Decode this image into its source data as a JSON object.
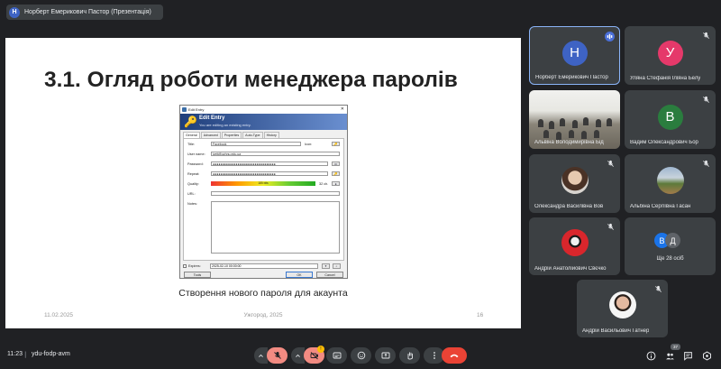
{
  "presenter_bar": {
    "avatar_letter": "Н",
    "title": "Норберт Емерикович Пастор (Презентація)"
  },
  "slide": {
    "title": "3.1. Огляд роботи менеджера паролів",
    "caption": "Створення нового пароля для акаунта",
    "footer_date": "11.02.2025",
    "footer_city": "Ужгород, 2025",
    "page_number": "16"
  },
  "dialog": {
    "window_title": "Edit Entry",
    "header_title": "Edit Entry",
    "header_subtitle": "You are editing an existing entry.",
    "tabs": [
      "General",
      "Advanced",
      "Properties",
      "Auto-Type",
      "History"
    ],
    "labels": {
      "title": "Title:",
      "username": "User name:",
      "password": "Password:",
      "repeat": "Repeat:",
      "quality": "Quality:",
      "url": "URL:",
      "notes": "Notes:",
      "expires": "Expires:"
    },
    "title_value": "Facebook",
    "icon_label": "Icon:",
    "username_value": "ivett@uzhnu.edu.ua",
    "password_mask": "●●●●●●●●●●●●●●●●●●●●●●●●●●●●●●●●●",
    "repeat_mask": "●●●●●●●●●●●●●●●●●●●●●●●●●●●●●●●●●",
    "quality_text": "185 bits",
    "quality_chars": "32 ch.",
    "expires_value": "2025-02-10 00:00:00",
    "buttons": {
      "tools": "Tools",
      "ok": "OK",
      "cancel": "Cancel"
    }
  },
  "participants": [
    {
      "name": "Норберт Емерикович Пастор",
      "letter": "Н",
      "color": "#3e63c4",
      "speaking": true
    },
    {
      "name": "Уляна Стефанія Іліяна Белу",
      "letter": "У",
      "color": "#e5396a",
      "muted": true
    },
    {
      "name": "Альвіна Володимирівна Бід",
      "type": "classroom"
    },
    {
      "name": "Вадим Олександрович Бор",
      "letter": "В",
      "color": "#2a7d3e",
      "muted": true
    },
    {
      "name": "Олександра Василівна Вов",
      "type": "photo",
      "muted": true
    },
    {
      "name": "Альбіна Сергіївна Гасан",
      "type": "photo",
      "muted": true
    },
    {
      "name": "Андрій Анатолійович Свєчко",
      "type": "photo",
      "muted": true
    },
    {
      "name": "Андрій Васильович Гатнер",
      "type": "photo",
      "muted": true
    }
  ],
  "more_tile": {
    "letter1": "В",
    "letter2": "Д",
    "count_text": "Ще 28 осіб"
  },
  "bottom_bar": {
    "time": "11:23",
    "separator": "|",
    "meeting_code": "ydu-fodp-avm",
    "reaction_badge": "!",
    "participants_count": "37"
  },
  "colors": {
    "background": "#202124",
    "tile": "#3c4043",
    "accent": "#8ab4f8",
    "end_call": "#ea4335",
    "muted_control": "#f28b82"
  }
}
